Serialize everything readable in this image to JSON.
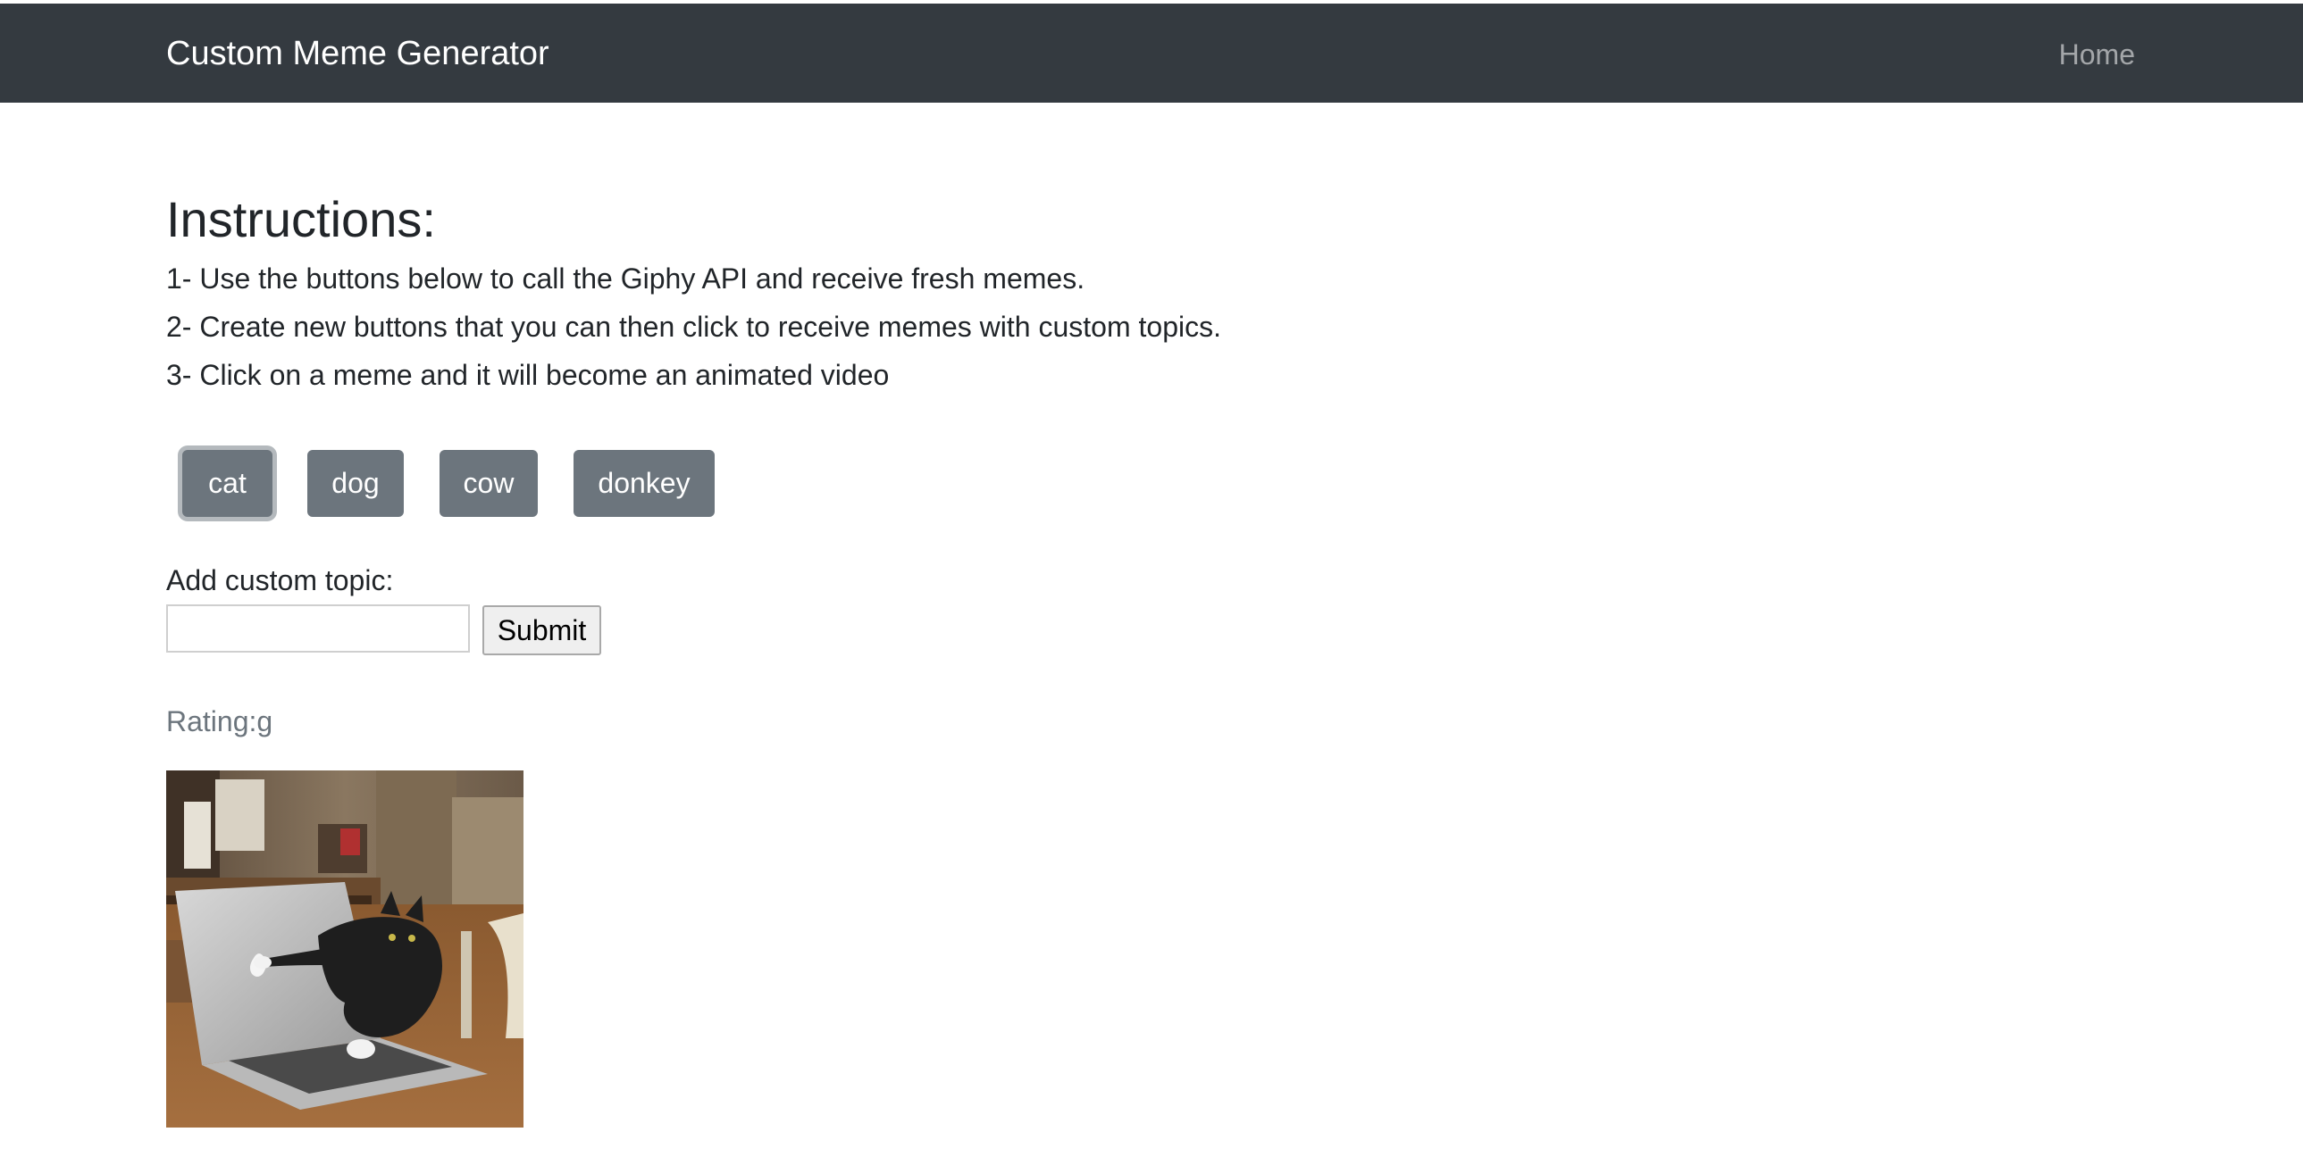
{
  "navbar": {
    "brand": "Custom Meme Generator",
    "home_link": "Home",
    "background": "#343a40"
  },
  "instructions": {
    "heading": "Instructions:",
    "steps": [
      "1- Use the buttons below to call the Giphy API and receive fresh memes.",
      "2- Create new buttons that you can then click to receive memes with custom topics.",
      "3- Click on a meme and it will become an animated video"
    ]
  },
  "topics": {
    "buttons": [
      "cat",
      "dog",
      "cow",
      "donkey"
    ],
    "focused": "cat",
    "button_color": "#6c757d"
  },
  "form": {
    "label": "Add custom topic:",
    "input_value": "",
    "submit_label": "Submit"
  },
  "results": {
    "rating_text": "Rating:g",
    "memes": [
      {
        "icon": "cat-typing-on-laptop-image"
      }
    ]
  }
}
